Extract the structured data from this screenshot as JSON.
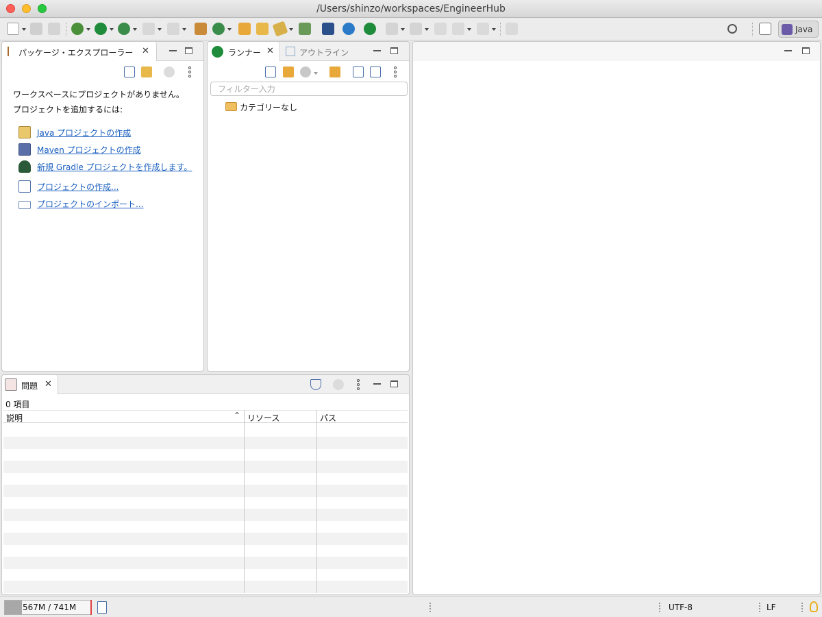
{
  "window": {
    "title": "/Users/shinzo/workspaces/EngineerHub"
  },
  "toolbar": {
    "perspective_label": "Java"
  },
  "package_explorer": {
    "tab_label": "パッケージ・エクスプローラー",
    "empty_line1": "ワークスペースにプロジェクトがありません。",
    "empty_line2": "プロジェクトを追加するには:",
    "links": [
      {
        "label": "Java プロジェクトの作成",
        "icon": "java-project-icon"
      },
      {
        "label": "Maven プロジェクトの作成",
        "icon": "maven-project-icon"
      },
      {
        "label": "新規 Gradle プロジェクトを作成します。",
        "icon": "gradle-icon"
      },
      {
        "label": "プロジェクトの作成...",
        "icon": "new-project-icon"
      },
      {
        "label": "プロジェクトのインポート...",
        "icon": "import-icon"
      }
    ]
  },
  "runner": {
    "tab_label": "ランナー",
    "outline_tab_label": "アウトライン",
    "filter_placeholder": "フィルター入力",
    "tree": [
      {
        "label": "カテゴリーなし",
        "icon": "folder-open-icon"
      }
    ]
  },
  "problems": {
    "tab_label": "問題",
    "item_count": "0 項目",
    "columns": [
      "説明",
      "リソース",
      "パス"
    ]
  },
  "statusbar": {
    "heap": "567M / 741M",
    "heap_used_fraction": 0.2,
    "encoding": "UTF-8",
    "line_ending": "LF"
  },
  "colors": {
    "link": "#1a5fbf",
    "run_green": "#1e8c3a",
    "folder": "#e8a93a"
  }
}
